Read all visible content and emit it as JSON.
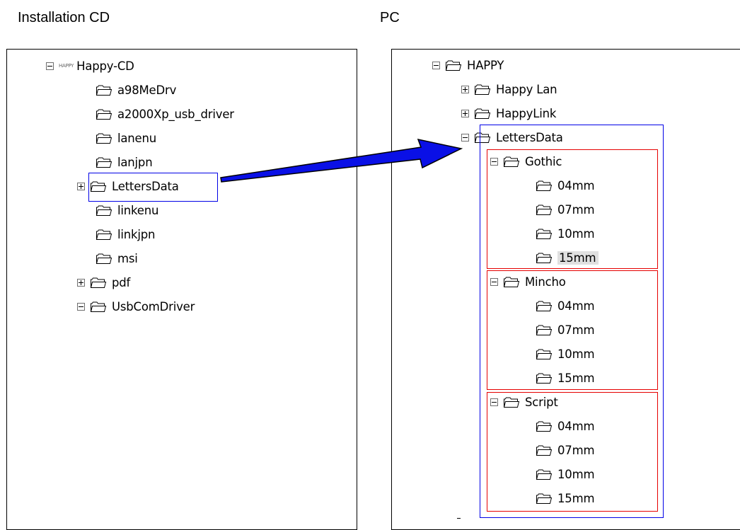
{
  "captions": {
    "left": "Installation CD",
    "right": "PC"
  },
  "cd_tree": {
    "root": {
      "logo": "HAPPY",
      "label": "Happy-CD"
    },
    "items": [
      {
        "label": "a98MeDrv"
      },
      {
        "label": "a2000Xp_usb_driver"
      },
      {
        "label": "lanenu"
      },
      {
        "label": "lanjpn"
      },
      {
        "label": "LettersData"
      },
      {
        "label": "linkenu"
      },
      {
        "label": "linkjpn"
      },
      {
        "label": "msi"
      },
      {
        "label": "pdf"
      },
      {
        "label": "UsbComDriver"
      }
    ]
  },
  "pc_tree": {
    "root": {
      "label": "HAPPY"
    },
    "children": [
      {
        "label": "Happy Lan"
      },
      {
        "label": "HappyLink"
      },
      {
        "label": "LettersData"
      }
    ],
    "fonts": [
      {
        "label": "Gothic",
        "sizes": [
          "04mm",
          "07mm",
          "10mm",
          "15mm"
        ]
      },
      {
        "label": "Mincho",
        "sizes": [
          "04mm",
          "07mm",
          "10mm",
          "15mm"
        ]
      },
      {
        "label": "Script",
        "sizes": [
          "04mm",
          "07mm",
          "10mm",
          "15mm"
        ]
      }
    ]
  },
  "colors": {
    "highlight_blue": "#0000e6",
    "highlight_red": "#e60000",
    "arrow_fill": "#0a10e6"
  }
}
